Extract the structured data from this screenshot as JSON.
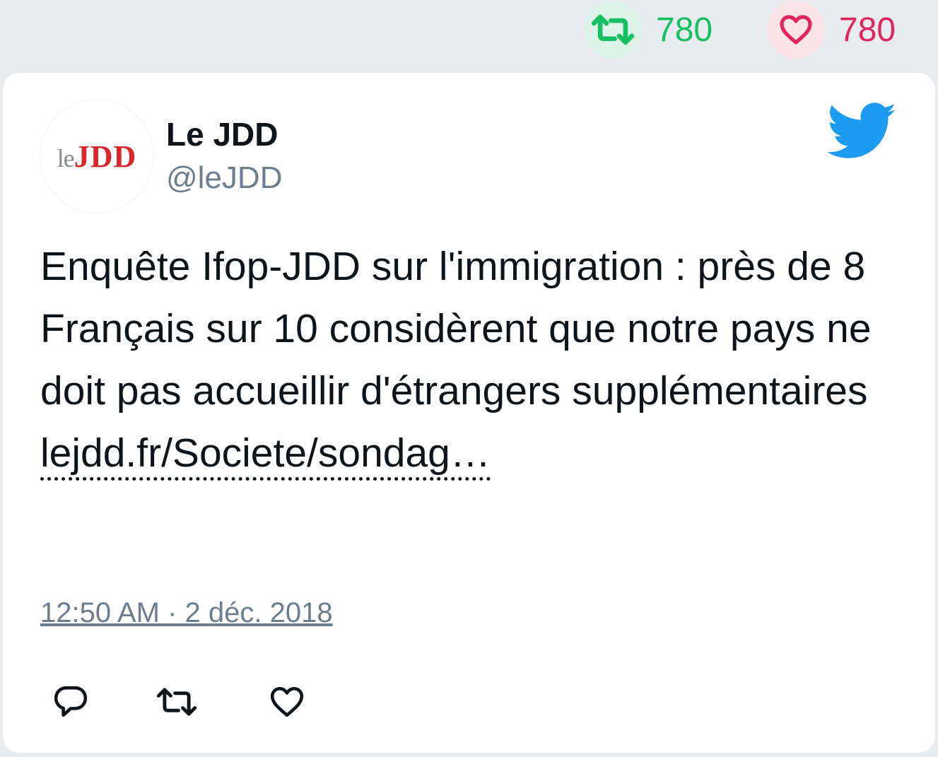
{
  "stats": {
    "retweets": "780",
    "likes": "780",
    "retweet_color": "#17bf63",
    "like_color": "#e0245e"
  },
  "tweet": {
    "avatar_logo_prefix": "le",
    "avatar_logo_main": "JDD",
    "author_name": "Le JDD",
    "author_handle": "@leJDD",
    "text": "Enquête Ifop-JDD sur l'immigration : près de 8 Français sur 10 considèrent que notre pays ne doit pas accueillir d'étrangers supplémentaires",
    "link_text": "lejdd.fr/Societe/sondag…",
    "timestamp": "12:50 AM · 2 déc. 2018"
  },
  "icons": {
    "brand": "twitter-bird-icon",
    "reply": "reply-icon",
    "retweet": "retweet-icon",
    "like": "heart-icon"
  },
  "colors": {
    "twitter_blue": "#1d9bf0",
    "avatar_red": "#d8262c"
  }
}
